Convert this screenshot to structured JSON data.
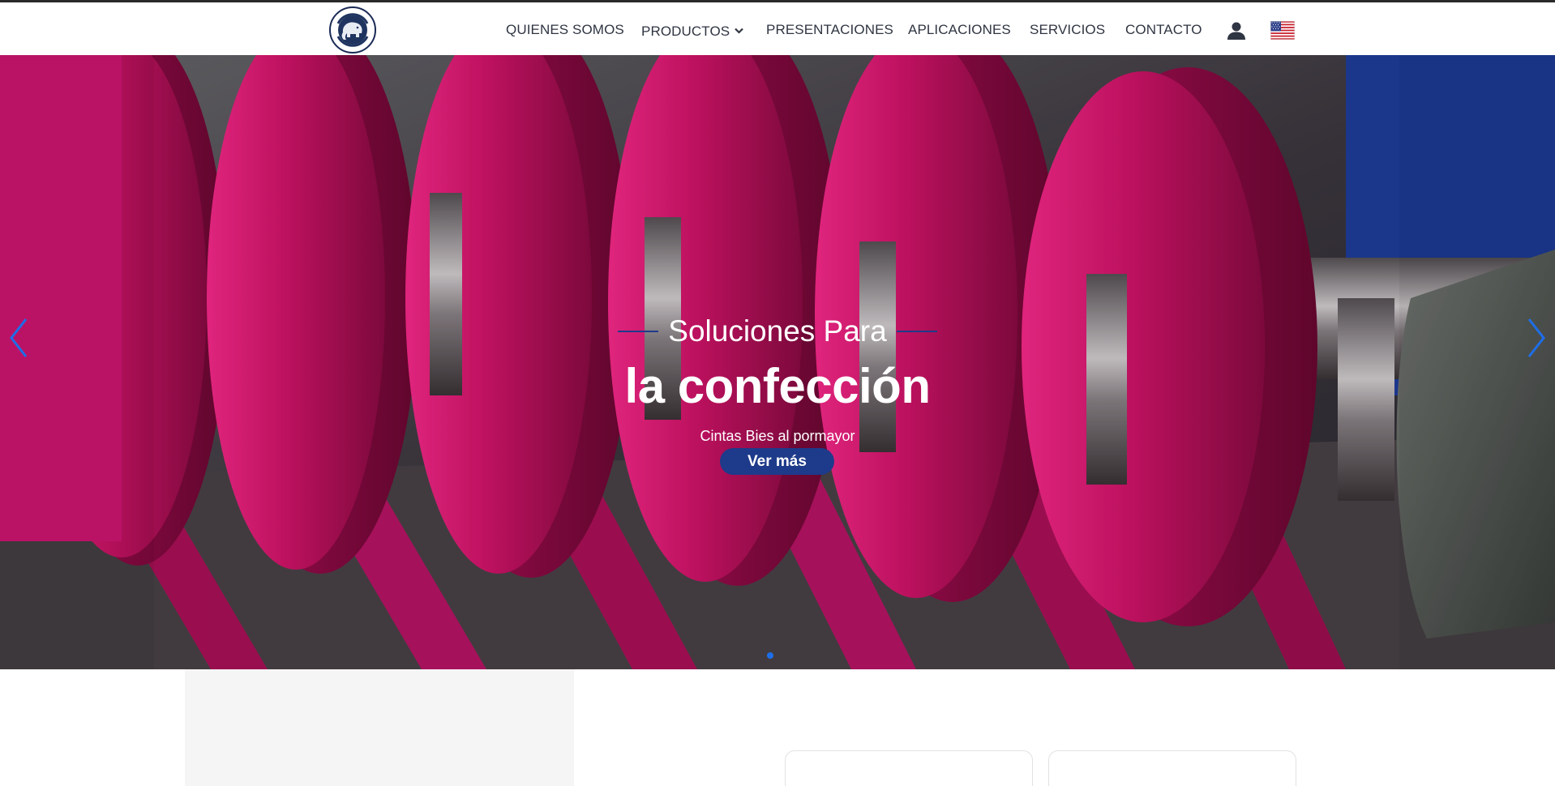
{
  "header": {
    "logo": {
      "icon": "elephant-logo",
      "ring_text_top": "BIES",
      "ring_text_bottom": "EL ELEFANTE"
    },
    "nav": [
      {
        "label": "QUIENES SOMOS"
      },
      {
        "label": "PRODUCTOS",
        "has_dropdown": true
      },
      {
        "label": "PRESENTACIONES"
      },
      {
        "label": "APLICACIONES"
      },
      {
        "label": "SERVICIOS"
      },
      {
        "label": "CONTACTO"
      }
    ],
    "user_icon": "user-icon",
    "language_icon": "us-flag-icon"
  },
  "hero": {
    "eyebrow": "Soluciones Para",
    "headline": "la confección",
    "subline": "Cintas Bies al pormayor",
    "cta_label": "Ver más",
    "slides_count": 1,
    "active_slide": 1
  },
  "colors": {
    "brand_navy": "#1e3a8a",
    "accent_blue": "#1e6ee8",
    "ribbon_pink": "#d4156a"
  }
}
